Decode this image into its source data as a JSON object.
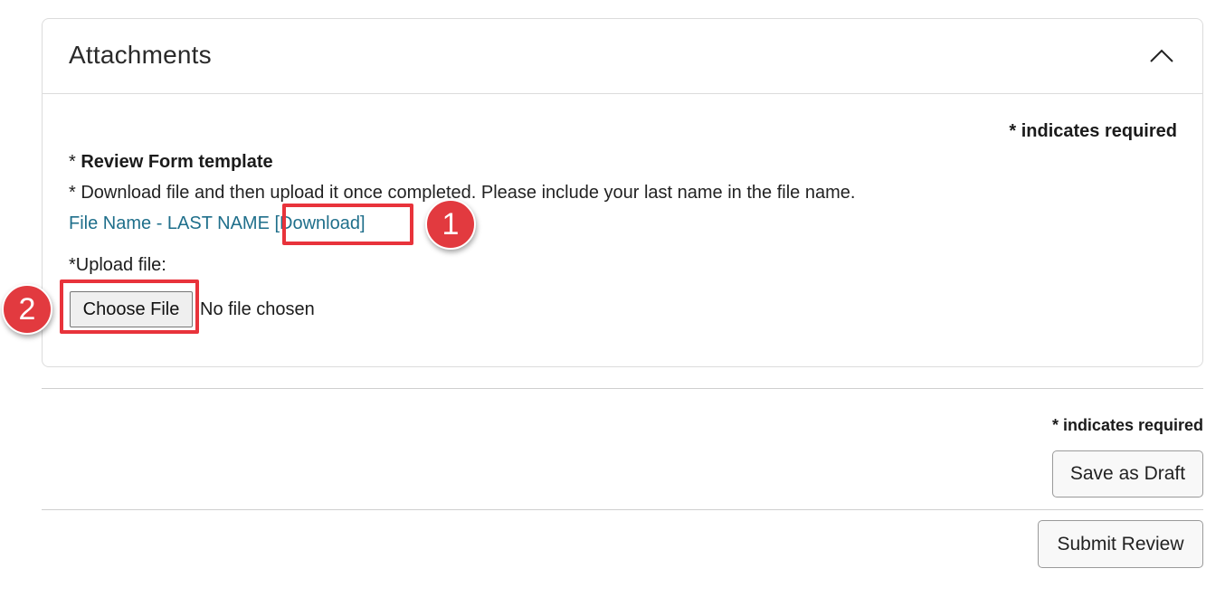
{
  "section": {
    "title": "Attachments",
    "toggle_icon": "chevron-up-icon"
  },
  "form": {
    "required_note": "* indicates required",
    "field_asterisk": "* ",
    "field_title": "Review Form template",
    "instructions": "* Download file and then upload it once completed. Please include your last name in the file name.",
    "file_name": "File Name - LAST NAME",
    "download_link": "[Download]",
    "upload_label": "*Upload file:",
    "choose_file_label": "Choose File",
    "no_file_text": "No file chosen"
  },
  "annotations": [
    {
      "number": "1",
      "target": "download-link"
    },
    {
      "number": "2",
      "target": "choose-file-button"
    }
  ],
  "annotation_color": "#e8333b",
  "link_color": "#1f6f8b",
  "footer": {
    "required_note": "* indicates required",
    "save_draft_label": "Save as Draft",
    "submit_label": "Submit Review"
  }
}
